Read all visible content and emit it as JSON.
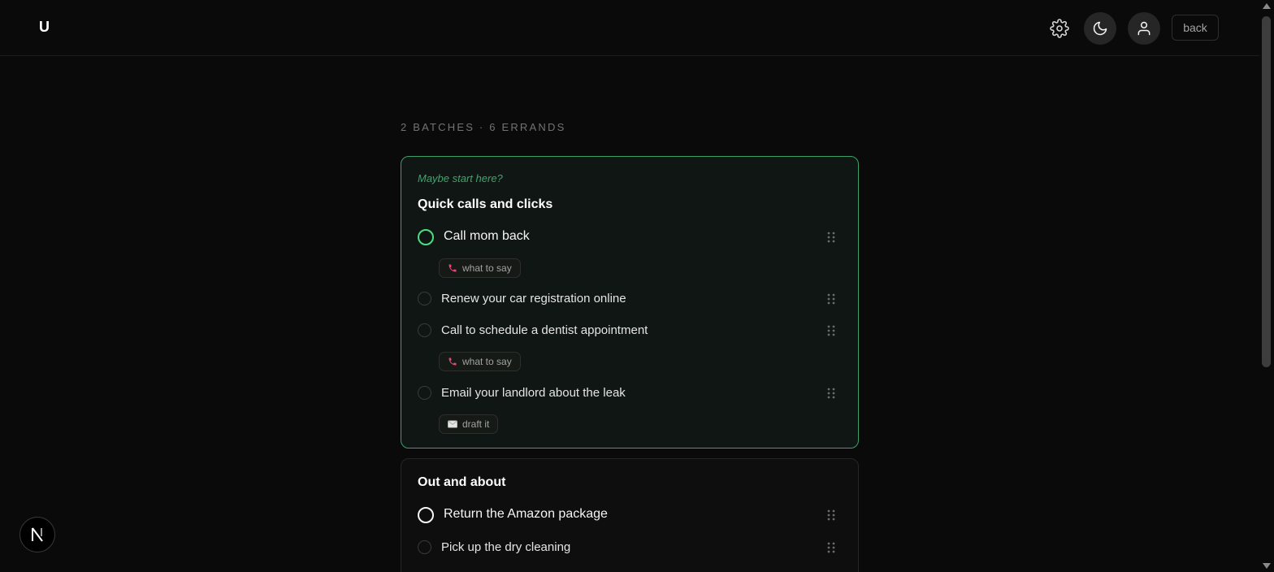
{
  "header": {
    "logo": "U",
    "back_label": "back",
    "icons": [
      "gear-icon",
      "moon-icon",
      "user-icon"
    ]
  },
  "summary": "2 BATCHES · 6 ERRANDS",
  "batches": [
    {
      "suggestion": "Maybe start here?",
      "title": "Quick calls and clicks",
      "accent": "#4ade80",
      "items": [
        {
          "label": "Call mom back",
          "chip": {
            "icon": "phone-icon",
            "label": "what to say"
          }
        },
        {
          "label": "Renew your car registration online"
        },
        {
          "label": "Call to schedule a dentist appointment",
          "chip": {
            "icon": "phone-icon",
            "label": "what to say"
          }
        },
        {
          "label": "Email your landlord about the leak",
          "chip": {
            "icon": "envelope-icon",
            "label": "draft it"
          }
        }
      ]
    },
    {
      "title": "Out and about",
      "items": [
        {
          "label": "Return the Amazon package"
        },
        {
          "label": "Pick up the dry cleaning"
        }
      ]
    }
  ],
  "colors": {
    "background": "#0a0a0a",
    "accent_green": "#4ade80",
    "phone_icon": "#e8457a"
  }
}
